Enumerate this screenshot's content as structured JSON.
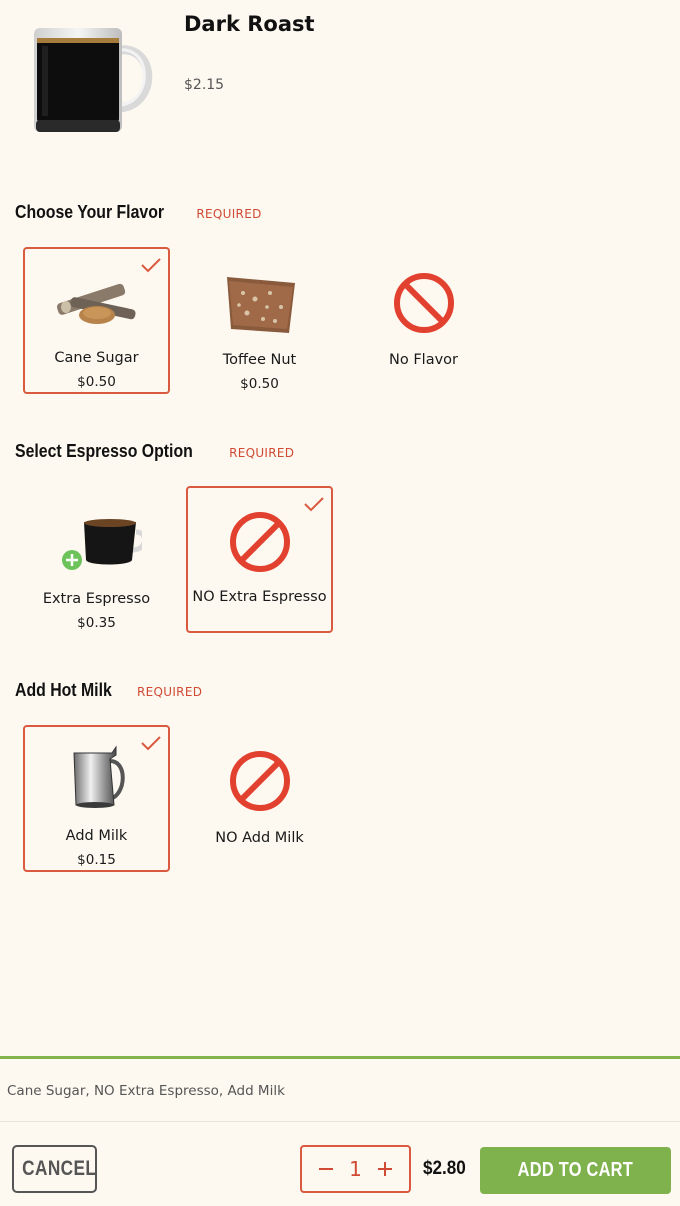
{
  "product": {
    "name": "Dark Roast",
    "price": "$2.15"
  },
  "sections": [
    {
      "title": "Choose Your Flavor",
      "required": "REQUIRED",
      "options": [
        {
          "label": "Cane Sugar",
          "price": "$0.50",
          "selected": true,
          "icon": "cane-sugar-image"
        },
        {
          "label": "Toffee Nut",
          "price": "$0.50",
          "selected": false,
          "icon": "toffee-nut-image"
        },
        {
          "label": "No Flavor",
          "price": "",
          "selected": false,
          "icon": "no-symbol-icon"
        }
      ]
    },
    {
      "title": "Select Espresso Option",
      "required": "REQUIRED",
      "options": [
        {
          "label": "Extra Espresso",
          "price": "$0.35",
          "selected": false,
          "icon": "espresso-cup-image"
        },
        {
          "label": "NO Extra Espresso",
          "price": "",
          "selected": true,
          "icon": "no-symbol-icon"
        }
      ]
    },
    {
      "title": "Add Hot Milk",
      "required": "REQUIRED",
      "options": [
        {
          "label": "Add Milk",
          "price": "$0.15",
          "selected": true,
          "icon": "milk-pitcher-image"
        },
        {
          "label": "NO Add Milk",
          "price": "",
          "selected": false,
          "icon": "no-symbol-icon"
        }
      ]
    }
  ],
  "summary": "Cane Sugar, NO Extra Espresso, Add Milk",
  "footer": {
    "cancel_label": "CANCEL",
    "quantity": "1",
    "total": "$2.80",
    "add_to_cart_label": "ADD TO CART"
  },
  "colors": {
    "accent": "#d95a3f",
    "green": "#7fb14d",
    "background": "#fdf9f1"
  }
}
